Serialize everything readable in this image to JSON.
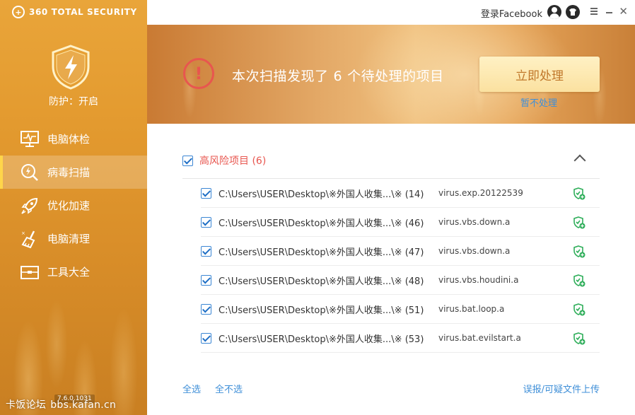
{
  "app": {
    "logo_text": "360 TOTAL SECURITY",
    "protection_status": "防护：开启",
    "version": "7.6.0.1031",
    "watermark": "卡饭论坛",
    "watermark_url": "bbs.kafan.cn"
  },
  "sidebar": {
    "items": [
      {
        "label": "电脑体检",
        "icon": "monitor-pulse-icon",
        "active": false
      },
      {
        "label": "病毒扫描",
        "icon": "scan-magnifier-icon",
        "active": true
      },
      {
        "label": "优化加速",
        "icon": "rocket-icon",
        "active": false
      },
      {
        "label": "电脑清理",
        "icon": "broom-icon",
        "active": false
      },
      {
        "label": "工具大全",
        "icon": "toolbox-icon",
        "active": false
      }
    ]
  },
  "topbar": {
    "login_label": "登录Facebook"
  },
  "banner": {
    "message_prefix": "本次扫描发现了",
    "count": "6",
    "message_suffix": "个待处理的项目",
    "primary_button": "立即处理",
    "secondary_link": "暂不处理"
  },
  "group": {
    "title": "高风险项目 (6)",
    "checked": true,
    "rows": [
      {
        "path": "C:\\Users\\USER\\Desktop\\※外国人收集...\\※ (14)",
        "virus": "virus.exp.20122539",
        "checked": true
      },
      {
        "path": "C:\\Users\\USER\\Desktop\\※外国人收集...\\※ (46)",
        "virus": "virus.vbs.down.a",
        "checked": true
      },
      {
        "path": "C:\\Users\\USER\\Desktop\\※外国人收集...\\※ (47)",
        "virus": "virus.vbs.down.a",
        "checked": true
      },
      {
        "path": "C:\\Users\\USER\\Desktop\\※外国人收集...\\※ (48)",
        "virus": "virus.vbs.houdini.a",
        "checked": true
      },
      {
        "path": "C:\\Users\\USER\\Desktop\\※外国人收集...\\※ (51)",
        "virus": "virus.bat.loop.a",
        "checked": true
      },
      {
        "path": "C:\\Users\\USER\\Desktop\\※外国人收集...\\※ (53)",
        "virus": "virus.bat.evilstart.a",
        "checked": true
      }
    ]
  },
  "footer": {
    "select_all": "全选",
    "select_none": "全不选",
    "report_link": "误报/可疑文件上传"
  },
  "colors": {
    "accent_orange": "#e39a2f",
    "danger_red": "#e8564f",
    "link_blue": "#3f8fd8",
    "trust_green": "#2fae5a"
  }
}
